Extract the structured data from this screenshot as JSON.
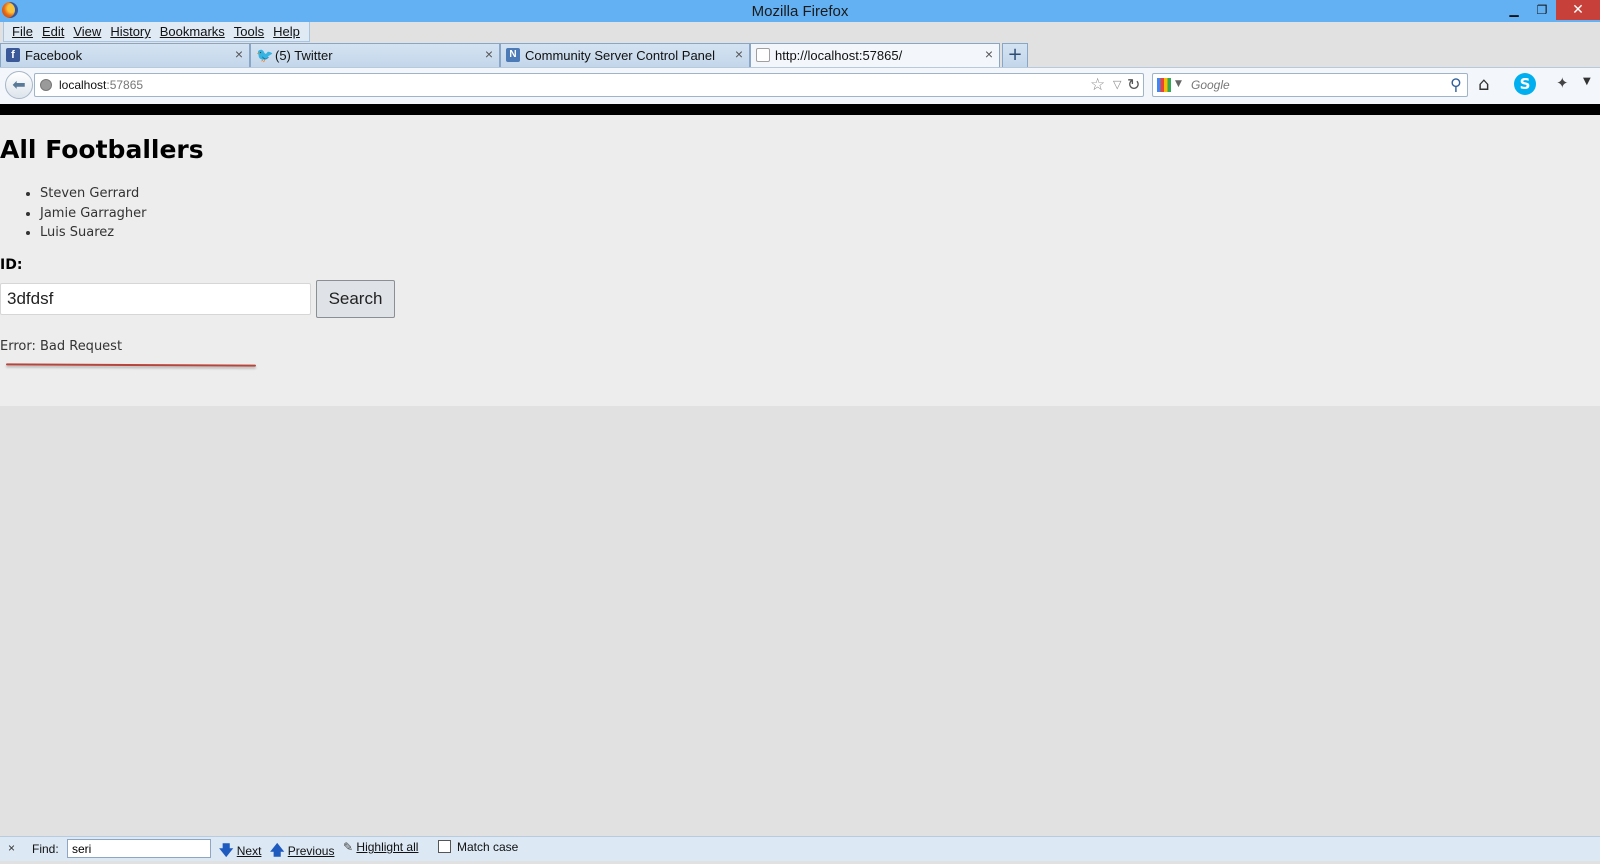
{
  "window": {
    "title": "Mozilla Firefox",
    "controls": {
      "minimize": "▁",
      "maximize": "❐",
      "close": "✕"
    }
  },
  "menu": [
    {
      "label": "File"
    },
    {
      "label": "Edit"
    },
    {
      "label": "View"
    },
    {
      "label": "History"
    },
    {
      "label": "Bookmarks"
    },
    {
      "label": "Tools"
    },
    {
      "label": "Help"
    }
  ],
  "tabs": [
    {
      "label": "Facebook",
      "icon": "facebook-icon",
      "active": false
    },
    {
      "label": "(5) Twitter",
      "icon": "twitter-icon",
      "active": false
    },
    {
      "label": "Community Server Control Panel",
      "icon": "community-server-icon",
      "active": false
    },
    {
      "label": "http://localhost:57865/",
      "icon": "blank-page-icon",
      "active": true
    }
  ],
  "new_tab": "+",
  "navbar": {
    "url_host": "localhost",
    "url_port": ":57865",
    "search_placeholder": "Google"
  },
  "page": {
    "title": "All Footballers",
    "players": [
      "Steven Gerrard",
      "Jamie Garragher",
      "Luis Suarez"
    ],
    "id_label": "ID:",
    "id_value": "3dfdsf",
    "search_button": "Search",
    "error": "Error: Bad Request"
  },
  "findbar": {
    "close": "×",
    "label": "Find:",
    "value": "seri",
    "next": "Next",
    "previous": "Previous",
    "highlight_all": "Highlight all",
    "match_case": "Match case"
  },
  "colors": {
    "titlebar": "#63b1f2",
    "close_button": "#c7403a",
    "annotation_underline": "#b8453b"
  }
}
